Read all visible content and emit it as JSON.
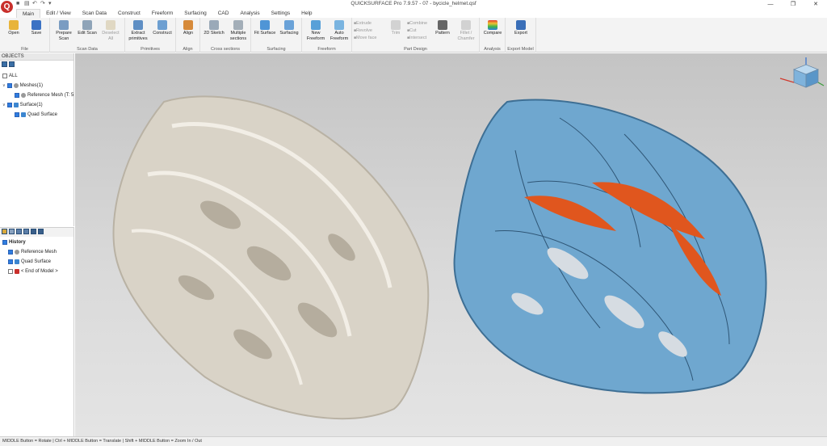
{
  "window": {
    "title": "QUICKSURFACE Pro 7.9.57 - 07 - bycicle_helmet.qsf",
    "logo": "Q",
    "controls": [
      "—",
      "❐",
      "✕"
    ]
  },
  "menu": {
    "tabs": [
      "Main",
      "Edit / View",
      "Scan Data",
      "Construct",
      "Freeform",
      "Surfacing",
      "CAD",
      "Analysis",
      "Settings",
      "Help"
    ],
    "active": "Main"
  },
  "ribbon": {
    "groups": {
      "file": {
        "label": "File",
        "open": "Open",
        "save": "Save"
      },
      "scan_data": {
        "label": "Scan Data",
        "prepare": "Prepare Scan",
        "edit": "Edit Scan",
        "deselect": "Deselect All"
      },
      "primitives": {
        "label": "Primitives",
        "extract": "Extract primitives",
        "construct": "Construct"
      },
      "align": {
        "label": "Align",
        "align": "Align"
      },
      "cross_sections": {
        "label": "Cross sections",
        "sketch": "2D Sketch",
        "multiple": "Multiple sections"
      },
      "surfacing": {
        "label": "Surfacing",
        "fit": "Fit Surface",
        "surfacing": "Surfacing"
      },
      "freeform": {
        "label": "Freeform",
        "new": "New Freeform",
        "auto": "Auto Freeform"
      },
      "part_design": {
        "label": "Part Design",
        "extrude": "Extrude",
        "revolve": "Revolve",
        "move_face": "Move face",
        "trim": "Trim",
        "combine": "Combine",
        "cut": "Cut",
        "intersect": "Intersect",
        "pattern": "Pattern",
        "fillet": "Fillet / Chamfer"
      },
      "analysis": {
        "label": "Analysis",
        "compare": "Compare"
      },
      "export_model": {
        "label": "Export Model",
        "export": "Export"
      }
    }
  },
  "objects": {
    "header": "OBJECTS",
    "all": "ALL",
    "meshes": "Meshes(1)",
    "reference_mesh": "Reference Mesh (T: 5",
    "surfaces": "Surface(1)",
    "quad_surface": "Quad Surface"
  },
  "history": {
    "title": "History",
    "items": [
      "Reference Mesh",
      "Quad Surface",
      "< End of Model >"
    ]
  },
  "status": {
    "text": "MIDDLE Button = Rotate | Ctrl + MIDDLE Button = Translate | Shift + MIDDLE Button = Zoom In / Out"
  },
  "colors": {
    "mesh": "#d9d3c7",
    "surface": "#6fa7cf",
    "surface_inner": "#e0561e",
    "accent": "#2f7de0"
  }
}
